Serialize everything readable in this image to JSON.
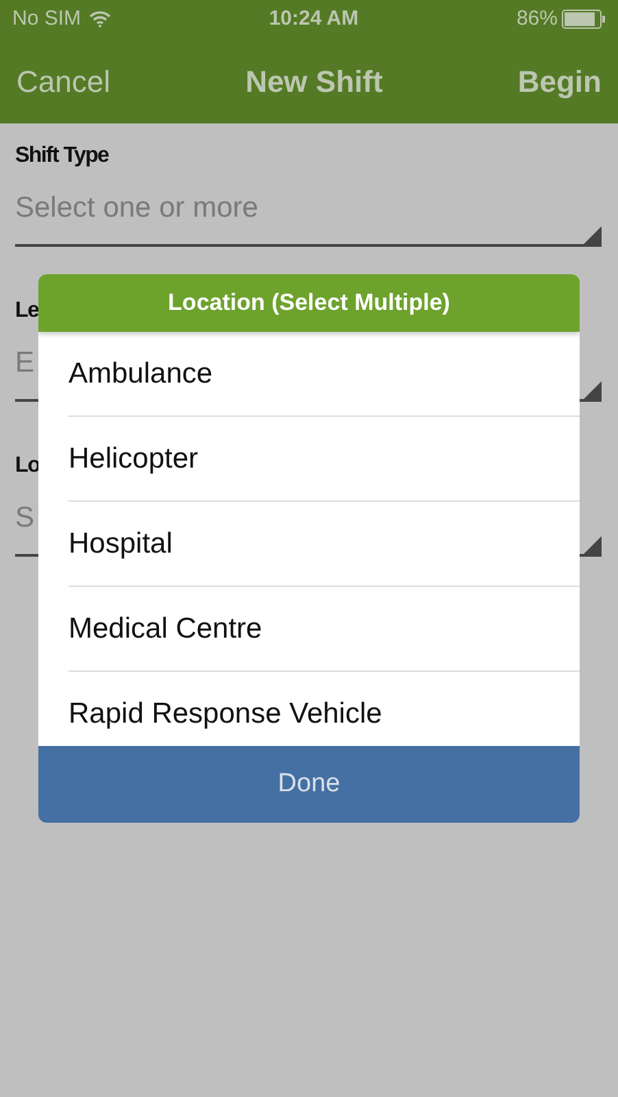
{
  "status_bar": {
    "carrier": "No SIM",
    "time": "10:24 AM",
    "battery": "86%"
  },
  "nav_bar": {
    "left": "Cancel",
    "title": "New Shift",
    "right": "Begin"
  },
  "fields": [
    {
      "label": "Shift Type",
      "placeholder": "Select one or more"
    },
    {
      "label": "Le",
      "placeholder": "E"
    },
    {
      "label": "Lo",
      "placeholder": "S"
    }
  ],
  "dialog": {
    "title": "Location (Select Multiple)",
    "options": [
      "Ambulance",
      "Helicopter",
      "Hospital",
      "Medical Centre",
      "Rapid Response Vehicle"
    ],
    "button": "Done"
  }
}
